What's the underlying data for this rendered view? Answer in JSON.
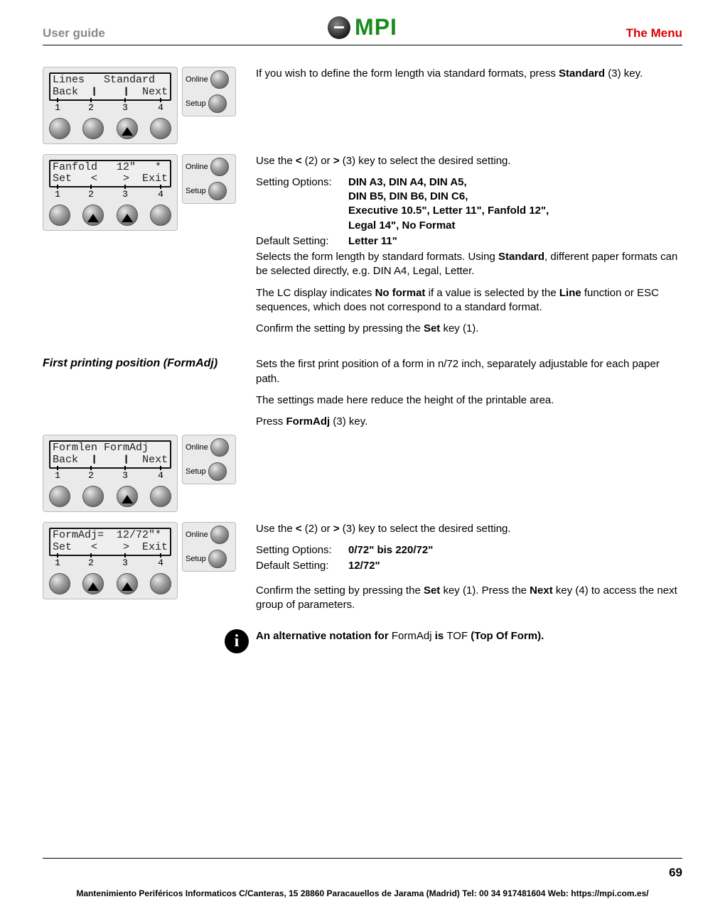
{
  "header": {
    "left": "User guide",
    "logo_text": "MPI",
    "right": "The Menu"
  },
  "panels": {
    "p1": {
      "line1": "Lines   Standard",
      "line2": "Back  ❙    ❙  Next",
      "btns_arrow": [
        false,
        false,
        true,
        false
      ]
    },
    "p2": {
      "line1": "Fanfold   12\"   *",
      "line2": "Set   <    >  Exit",
      "btns_arrow": [
        false,
        true,
        true,
        false
      ]
    },
    "p3": {
      "line1": "Formlen FormAdj",
      "line2": "Back  ❙    ❙  Next",
      "btns_arrow": [
        false,
        false,
        true,
        false
      ]
    },
    "p4": {
      "line1": "FormAdj=  12/72\"*",
      "line2": "Set   <    >  Exit",
      "btns_arrow": [
        false,
        true,
        true,
        false
      ]
    },
    "sideLabels": {
      "online": "Online",
      "setup": "Setup"
    },
    "ticks": {
      "t1": "1",
      "t2": "2",
      "t3": "3",
      "t4": "4"
    }
  },
  "body": {
    "b1_pre": "If you wish to define the form length via standard formats, press ",
    "b1_bold": "Standard",
    "b1_post": " (3) key.",
    "b2": "Use the < (2) or > (3) key to select the desired setting.",
    "b3_label": "Setting Options:",
    "b3_opts_l1": "DIN A3, DIN A4, DIN A5,",
    "b3_opts_l2": "DIN B5, DIN B6, DIN C6,",
    "b3_opts_l3": "Executive 10.5\", Letter 11\", Fanfold 12\",",
    "b3_opts_l4_bold": "Legal 14\"",
    "b3_opts_l4_rest": ", No Format",
    "b4_label": "Default Setting:",
    "b4_val": "Letter 11\"",
    "b5_pre": "Selects the form length by standard formats. Using ",
    "b5_bold": "Standard",
    "b5_post": ", different paper formats can be selected directly, e.g. DIN A4, Legal, Letter.",
    "b6_pre": "The LC display indicates ",
    "b6_bold1": "No format",
    "b6_mid": " if a value is selected by the ",
    "b6_bold2": "Line",
    "b6_post": " function or ESC sequences, which does not correspond to a standard format.",
    "b7_pre": "Confirm the setting by pressing the ",
    "b7_bold": "Set",
    "b7_post": " key (1).",
    "section2_title": "First printing position (FormAdj)",
    "c1": "Sets the first print position of a form in n/72 inch, separately adjustable for each paper path.",
    "c2": "The settings made here reduce the height of the printable area.",
    "c3_pre": "Press ",
    "c3_bold": "FormAdj",
    "c3_post": " (3) key.",
    "d1": "Use the < (2) or > (3) key to select the desired setting.",
    "d2_label": "Setting Options:",
    "d2_val": "0/72\" bis 220/72\"",
    "d3_label": "Default Setting:",
    "d3_val": "12/72\"",
    "d4_pre": "Confirm the setting by pressing the ",
    "d4_bold1": "Set",
    "d4_mid": " key (1). Press the ",
    "d4_bold2": "Next",
    "d4_post": " key (4) to access the next group of parameters.",
    "info_pre": "An alternative notation for ",
    "info_mid": "FormAdj ",
    "info_bold2": "is ",
    "info_mid2": "TOF ",
    "info_bold3": "(Top Of Form)."
  },
  "footer": {
    "page": "69",
    "text": "Mantenimiento Periféricos Informaticos C/Canteras, 15 28860 Paracauellos de Jarama (Madrid) Tel: 00 34 917481604  Web: https://mpi.com.es/"
  }
}
